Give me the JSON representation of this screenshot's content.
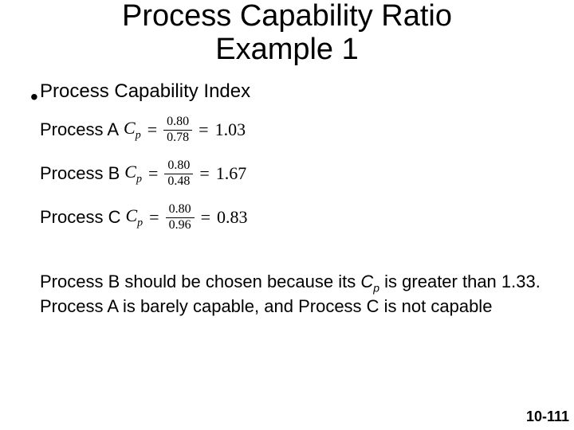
{
  "title_line1": "Process Capability Ratio",
  "title_line2": "Example 1",
  "bullet_glyph": "•",
  "subtitle": "Process Capability Index",
  "cp_symbol_var": "C",
  "cp_symbol_sub": "p",
  "eq_sign": "=",
  "rows": {
    "a": {
      "label": "Process A",
      "num": "0.80",
      "den": "0.78",
      "result": "1.03"
    },
    "b": {
      "label": "Process B",
      "num": "0.80",
      "den": "0.48",
      "result": "1.67"
    },
    "c": {
      "label": "Process C",
      "num": "0.80",
      "den": "0.96",
      "result": "0.83"
    }
  },
  "conclusion_pre": "Process B should be chosen because its ",
  "conclusion_post": " is greater than 1.33.  Process A is barely capable, and Process C is not capable",
  "page_number": "10-111"
}
